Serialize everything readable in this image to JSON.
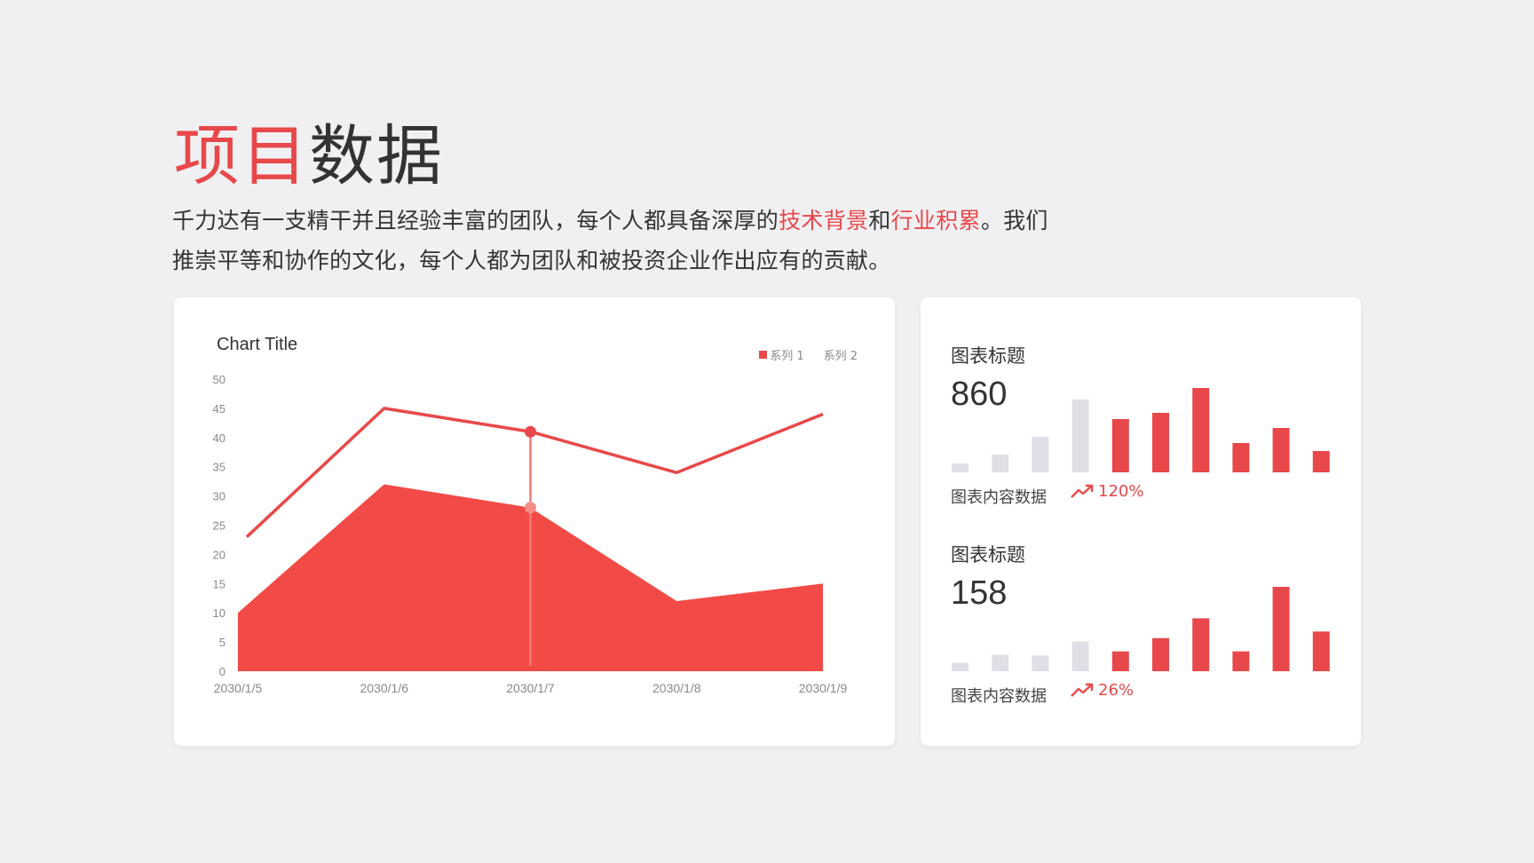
{
  "header": {
    "title_accent": "项目",
    "title_rest": "数据",
    "desc_part1": "千力达有一支精干并且经验丰富的团队，每个人都具备深厚的",
    "desc_hl1": "技术背景",
    "desc_part2": "和",
    "desc_hl2": "行业积累",
    "desc_part3": "。我们推崇平等和协作的文化，每个人都为团队和被投资企业作出应有的贡献。"
  },
  "colors": {
    "accent": "#e8484a",
    "area": "#f24a46",
    "muted_bar": "#dfdfe7",
    "background": "#f0f0f2"
  },
  "chart_data": [
    {
      "type": "line",
      "title": "Chart Title",
      "x": [
        "2030/1/5",
        "2030/1/6",
        "2030/1/7",
        "2030/1/8",
        "2030/1/9"
      ],
      "ylim": [
        0,
        50
      ],
      "yticks": [
        0,
        5,
        10,
        15,
        20,
        25,
        30,
        35,
        40,
        45,
        50
      ],
      "legend_position": "top-right",
      "grid": false,
      "series": [
        {
          "name": "系列 1",
          "type": "area",
          "values": [
            10,
            32,
            28,
            12,
            15
          ]
        },
        {
          "name": "系列 2",
          "type": "line",
          "values": [
            23,
            45,
            41,
            34,
            44
          ]
        }
      ],
      "highlight_index": 2
    },
    {
      "type": "bar",
      "title": "图表标题",
      "value_label": "860",
      "caption": "图表内容数据",
      "trend": "120%",
      "trend_icon": "trend-up-icon",
      "values": [
        1,
        2,
        4,
        8.2,
        6,
        6.7,
        9.5,
        3.3,
        5,
        2.4
      ],
      "muted_count": 4
    },
    {
      "type": "bar",
      "title": "图表标题",
      "value_label": "158",
      "caption": "图表内容数据",
      "trend": "26%",
      "trend_icon": "trend-up-icon",
      "values": [
        1,
        2,
        1.9,
        3.6,
        2.4,
        4,
        6.4,
        2.4,
        10.2,
        4.8
      ],
      "muted_count": 4
    }
  ]
}
